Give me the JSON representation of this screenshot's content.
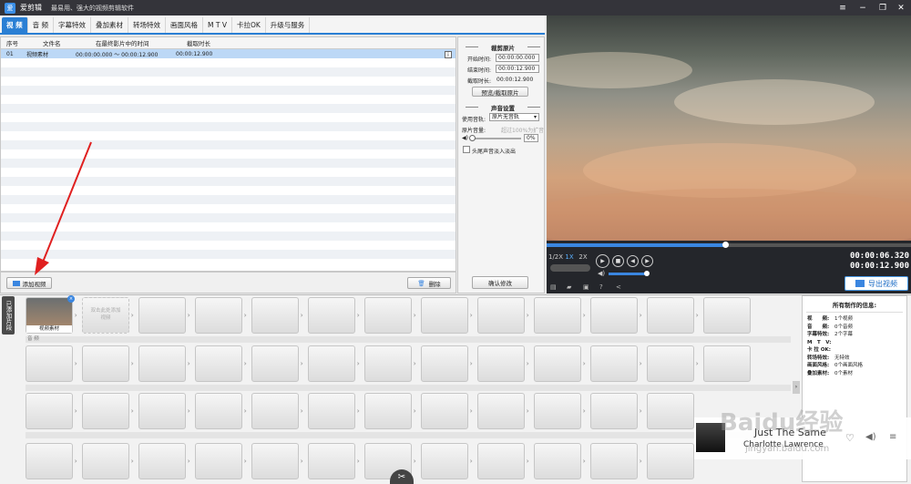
{
  "app": {
    "title": "爱剪辑",
    "tagline": "最易用、强大的视频剪辑软件",
    "logo": "爱"
  },
  "window_controls": {
    "menu": "≡",
    "minimize": "−",
    "restore": "❐",
    "close": "✕"
  },
  "tabs": [
    "视 频",
    "音 频",
    "字幕特效",
    "叠加素材",
    "转场特效",
    "画面风格",
    "M T V",
    "卡拉OK",
    "升级与服务"
  ],
  "list": {
    "headers": [
      "序号",
      "文件名",
      "在最终影片中的时间",
      "截取时长"
    ],
    "rows": [
      {
        "no": "01",
        "name": "视频素材",
        "time": "00:00:00.000 ～ 00:00:12.900",
        "dur": "00:00:12.900"
      }
    ],
    "add_button": "添加视频",
    "delete_button": "删除"
  },
  "settings": {
    "clip_section": "裁剪原片",
    "start_label": "开始时间:",
    "start_value": "00:00:00.000",
    "end_label": "结束时间:",
    "end_value": "00:00:12.900",
    "dur_label": "截取时长:",
    "dur_value": "00:00:12.900",
    "preview_button": "预览/截取原片",
    "audio_section": "声音设置",
    "track_label": "使用音轨:",
    "track_value": "原片无音轨",
    "volume_label": "原片音量:",
    "volume_hint": "超过100%为扩音",
    "volume_value": "0%",
    "fade_label": "头尾声音淡入淡出",
    "confirm_button": "确认修改"
  },
  "player": {
    "speeds": [
      "1/2X",
      "1X",
      "2X"
    ],
    "current_time": "00:00:06.320",
    "total_time": "00:00:12.900",
    "export_button": "导出视频"
  },
  "storyboard": {
    "added_tab": "已添加片段",
    "clip_label": "视频素材",
    "add_hint": "双击此处添加视频",
    "audio_lane": "音 频"
  },
  "info": {
    "title": "所有制作的信息:",
    "items": [
      {
        "k": "视　　频:",
        "v": "1个视频"
      },
      {
        "k": "音　　频:",
        "v": "0个音频"
      },
      {
        "k": "字幕特效:",
        "v": "2个字幕"
      },
      {
        "k": "M　T　V:",
        "v": ""
      },
      {
        "k": "卡 拉 OK:",
        "v": ""
      },
      {
        "k": "转场特效:",
        "v": "无特效"
      },
      {
        "k": "画面风格:",
        "v": "0个画面风格"
      },
      {
        "k": "叠加素材:",
        "v": "0个素材"
      }
    ]
  },
  "music": {
    "song": "Just The Same",
    "artist": "Charlotte Lawrence"
  },
  "watermark": {
    "text": "Baidu经验",
    "url": "jingyan.baidu.com"
  }
}
